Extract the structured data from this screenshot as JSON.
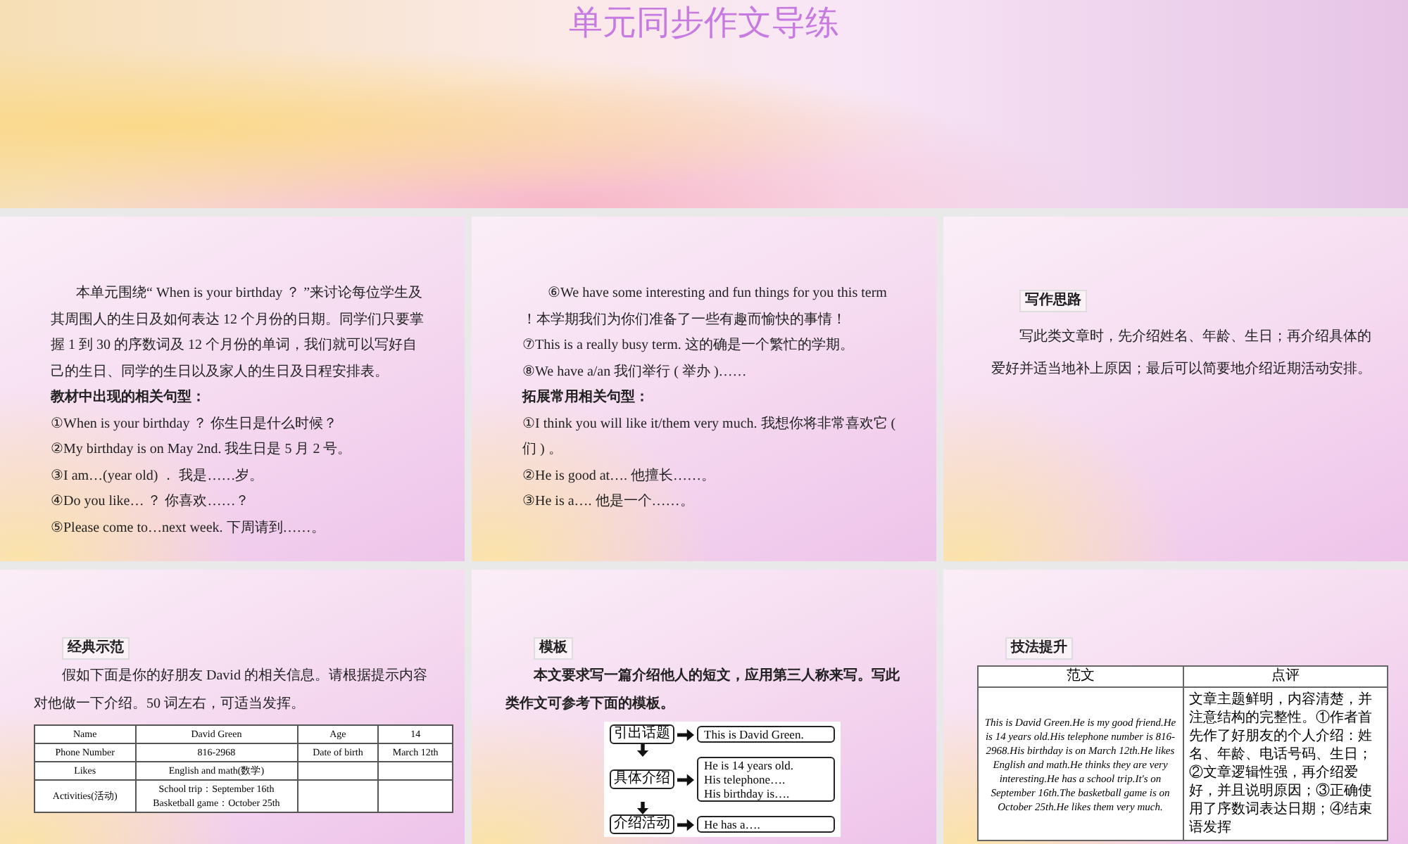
{
  "header": {
    "title": "单元同步作文导练"
  },
  "slides": [
    {
      "kind": "text",
      "paragraphs": [
        {
          "text": "本单元围绕“ When is your birthday ？ ”来讨论每位学生及其周围人的生日及如何表达 12 个月份的日期。同学们只要掌握 1 到 30 的序数词及 12 个月份的单词，我们就可以写好自己的生日、同学的生日以及家人的生日及日程安排表。",
          "bold": false
        },
        {
          "text": "教材中出现的相关句型：",
          "bold": true
        },
        {
          "text": "①When is your birthday ？ 你生日是什么时候？",
          "bold": false
        },
        {
          "text": "②My birthday is on May 2nd. 我生日是 5 月 2 号。",
          "bold": false
        },
        {
          "text": "③I am…(year old) ． 我是……岁。",
          "bold": false
        },
        {
          "text": "④Do you like… ？ 你喜欢……？",
          "bold": false
        },
        {
          "text": "⑤Please come to…next week. 下周请到……。",
          "bold": false
        }
      ]
    },
    {
      "kind": "text",
      "paragraphs": [
        {
          "text": "⑥We have some interesting and fun things for you this term ！本学期我们为你们准备了一些有趣而愉快的事情！",
          "bold": false
        },
        {
          "text": "⑦This is a really busy term. 这的确是一个繁忙的学期。",
          "bold": false
        },
        {
          "text": "⑧We have a/an 我们举行 ( 举办 )……",
          "bold": false
        },
        {
          "text": "拓展常用相关句型：",
          "bold": true
        },
        {
          "text": "①I think you will like it/them very much. 我想你将非常喜欢它 ( 们 ) 。",
          "bold": false
        },
        {
          "text": "②He is good at…. 他擅长……。",
          "bold": false
        },
        {
          "text": "③He is a…. 他是一个……。",
          "bold": false
        }
      ]
    },
    {
      "kind": "note",
      "tag": "写作思路",
      "text": "写此类文章时，先介绍姓名、年龄、生日；再介绍具体的爱好并适当地补上原因；最后可以简要地介绍近期活动安排。"
    },
    {
      "kind": "table",
      "tag": "经典示范",
      "text": "假如下面是你的好朋友 David 的相关信息。请根据提示内容对他做一下介绍。50 词左右，可适当发挥。",
      "rows": [
        {
          "cells": [
            [
              "Name"
            ],
            [
              "David Green"
            ],
            [
              "Age"
            ],
            [
              "14"
            ]
          ]
        },
        {
          "cells": [
            [
              "Phone Number"
            ],
            [
              "816-2968"
            ],
            [
              "Date of birth"
            ],
            [
              "March 12th"
            ]
          ]
        },
        {
          "cells": [
            [
              "Likes"
            ],
            [
              "English and math(数学)"
            ]
          ]
        },
        {
          "cells": [
            [
              "Activities(活动)"
            ],
            [
              "School trip：September 16th",
              "Basketball game：October 25th"
            ]
          ]
        }
      ]
    },
    {
      "kind": "diagram",
      "tag": "模板",
      "text": "本文要求写一篇介绍他人的短文，应用第三人称来写。写此类作文可参考下面的模板。",
      "steps": [
        {
          "label": "引出话题",
          "lines": [
            "This is David Green."
          ]
        },
        {
          "label": "具体介绍",
          "lines": [
            "He is 14 years old.",
            "His telephone….",
            "His birthday is…."
          ]
        },
        {
          "label": "介绍活动",
          "lines": [
            "He has a…."
          ]
        }
      ]
    },
    {
      "kind": "compare",
      "tag": "技法提升",
      "columns": [
        "范文",
        "点评"
      ],
      "cells": [
        "This is David Green.He is my good friend.He is 14 years old.His telephone number is 816- 2968.His birthday is on March 12th.He likes English and math.He thinks they are very interesting.He has a school trip.It's on September 16th.The basketball game is on October 25th.He likes them very much.",
        "文章主题鲜明，内容清楚，并注意结构的完整性。①作者首先作了好朋友的个人介绍：姓名、年龄、电话号码、生日；②文章逻辑性强，再介绍爱好，并且说明原因；③正确使用了序数词表达日期；④结束语发挥"
      ]
    }
  ]
}
